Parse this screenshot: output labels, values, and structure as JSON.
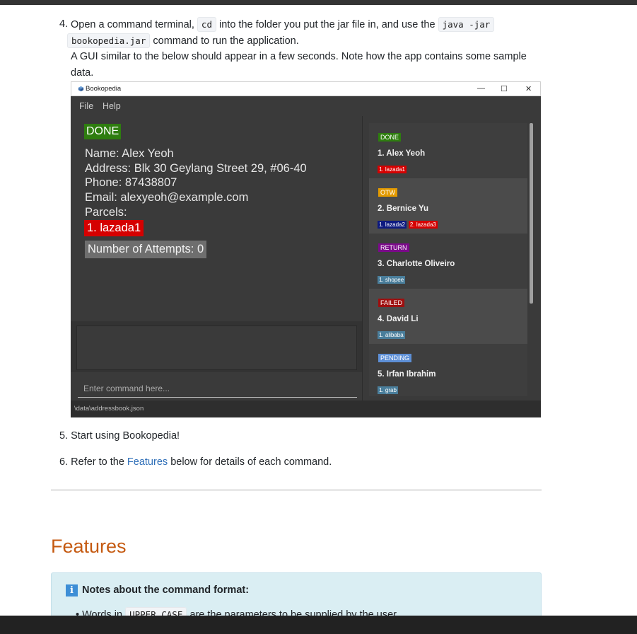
{
  "steps": {
    "step4": {
      "number": "4.",
      "part1": "Open a command terminal,",
      "code1": "cd",
      "part2": "into the folder you put the jar file in, and use the",
      "code2": "java -jar",
      "code3": "bookopedia.jar",
      "part3": "command to run the application.",
      "line3": "A GUI similar to the below should appear in a few seconds. Note how the app contains some sample",
      "line4": "data."
    },
    "step5": {
      "number": "5.",
      "text": "Start using Bookopedia!"
    },
    "step6": {
      "number": "6.",
      "pre": "Refer to the",
      "link": "Features",
      "post": "below for details of each command."
    }
  },
  "app": {
    "title": "Bookopedia",
    "window_controls": {
      "minimize": "—",
      "maximize": "☐",
      "close": "✕"
    },
    "menu": [
      "File",
      "Help"
    ],
    "detail": {
      "status": "DONE",
      "name": "Name: Alex Yeoh",
      "address": "Address: Blk 30 Geylang Street 29, #06-40",
      "phone": "Phone: 87438807",
      "email": "Email: alexyeoh@example.com",
      "parcels_label": "Parcels:",
      "parcel": "1. lazada1",
      "attempts": "Number of Attempts: 0"
    },
    "command_placeholder": "Enter command here...",
    "status_path": "\\data\\addressbook.json",
    "list": [
      {
        "status": "DONE",
        "status_color": "#2e7d0f",
        "name": "1.  Alex Yeoh",
        "parcels": [
          {
            "label": "1. lazada1",
            "color": "#d50000"
          }
        ]
      },
      {
        "status": "OTW",
        "status_color": "#e39a00",
        "name": "2.  Bernice Yu",
        "parcels": [
          {
            "label": "1. lazada2",
            "color": "#0d1a80"
          },
          {
            "label": "2. lazada3",
            "color": "#d50000"
          }
        ]
      },
      {
        "status": "RETURN",
        "status_color": "#7b0a8a",
        "name": "3.  Charlotte Oliveiro",
        "parcels": [
          {
            "label": "1. shopee",
            "color": "#4a7e9b"
          }
        ]
      },
      {
        "status": "FAILED",
        "status_color": "#9e0f0f",
        "name": "4.  David Li",
        "parcels": [
          {
            "label": "1. alibaba",
            "color": "#4a7e9b"
          }
        ]
      },
      {
        "status": "PENDING",
        "status_color": "#5d8fd6",
        "name": "5.  Irfan Ibrahim",
        "parcels": [
          {
            "label": "1. grab",
            "color": "#4a7e9b"
          }
        ]
      }
    ]
  },
  "features_heading": "Features",
  "notes": {
    "title": "Notes about the command format:",
    "bullet_pre": "Words in",
    "bullet_code": "UPPER_CASE",
    "bullet_post": "are the parameters to be supplied by the user."
  }
}
